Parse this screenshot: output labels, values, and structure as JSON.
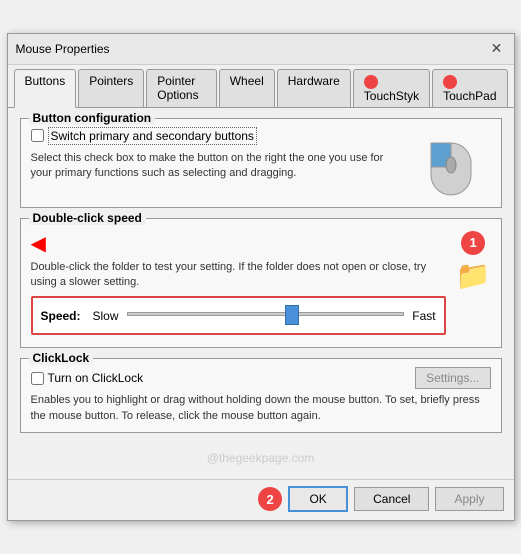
{
  "window": {
    "title": "Mouse Properties",
    "close_label": "✕"
  },
  "tabs": [
    {
      "label": "Buttons",
      "active": true
    },
    {
      "label": "Pointers",
      "active": false
    },
    {
      "label": "Pointer Options",
      "active": false
    },
    {
      "label": "Wheel",
      "active": false
    },
    {
      "label": "Hardware",
      "active": false
    },
    {
      "label": "TouchStyk",
      "active": false,
      "has_icon": true
    },
    {
      "label": "TouchPad",
      "active": false,
      "has_icon": true
    }
  ],
  "button_config": {
    "section_title": "Button configuration",
    "checkbox_label": "Switch primary and secondary buttons",
    "description": "Select this check box to make the button on the right the one you use for your primary functions such as selecting and dragging."
  },
  "double_click": {
    "title": "Double-click speed",
    "description": "Double-click the folder to test your setting. If the folder does not open or close, try using a slower setting.",
    "speed_label": "Speed:",
    "slow_label": "Slow",
    "fast_label": "Fast",
    "badge_number": "1",
    "slider_value": 60
  },
  "clicklock": {
    "title": "ClickLock",
    "checkbox_label": "Turn on ClickLock",
    "settings_label": "Settings...",
    "description": "Enables you to highlight or drag without holding down the mouse button. To set, briefly press the mouse button. To release, click the mouse button again."
  },
  "watermark": "@thegeekpage.com",
  "footer": {
    "ok_label": "OK",
    "cancel_label": "Cancel",
    "apply_label": "Apply",
    "badge_number": "2"
  }
}
